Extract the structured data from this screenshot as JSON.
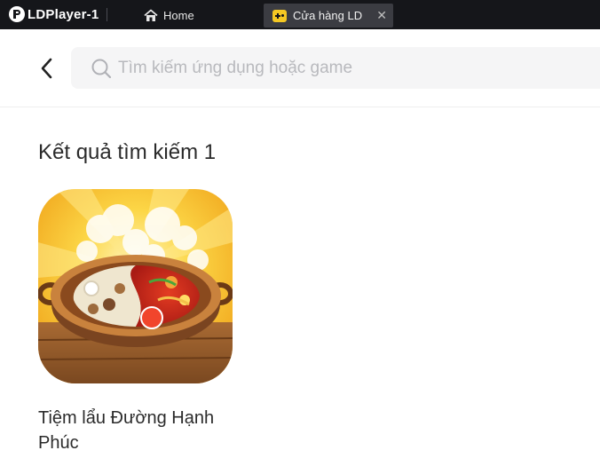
{
  "titlebar": {
    "app_name": "LDPlayer-1",
    "tabs": [
      {
        "label": "Home",
        "icon": "home-icon"
      },
      {
        "label": "Cửa hàng LD",
        "icon": "gamepad-icon",
        "active": true
      }
    ],
    "close_symbol": "✕"
  },
  "search": {
    "placeholder": "Tìm kiếm ứng dụng hoặc game",
    "value": ""
  },
  "results": {
    "title": "Kết quả tìm kiếm 1",
    "apps": [
      {
        "name": "Tiệm lẩu Đường Hạnh Phúc",
        "icon": "hotpot-game-icon"
      }
    ]
  },
  "colors": {
    "titlebar_bg": "#15161a",
    "active_tab_bg": "#3b3c42",
    "search_bg": "#f5f5f6",
    "accent_yellow": "#f5c823"
  }
}
